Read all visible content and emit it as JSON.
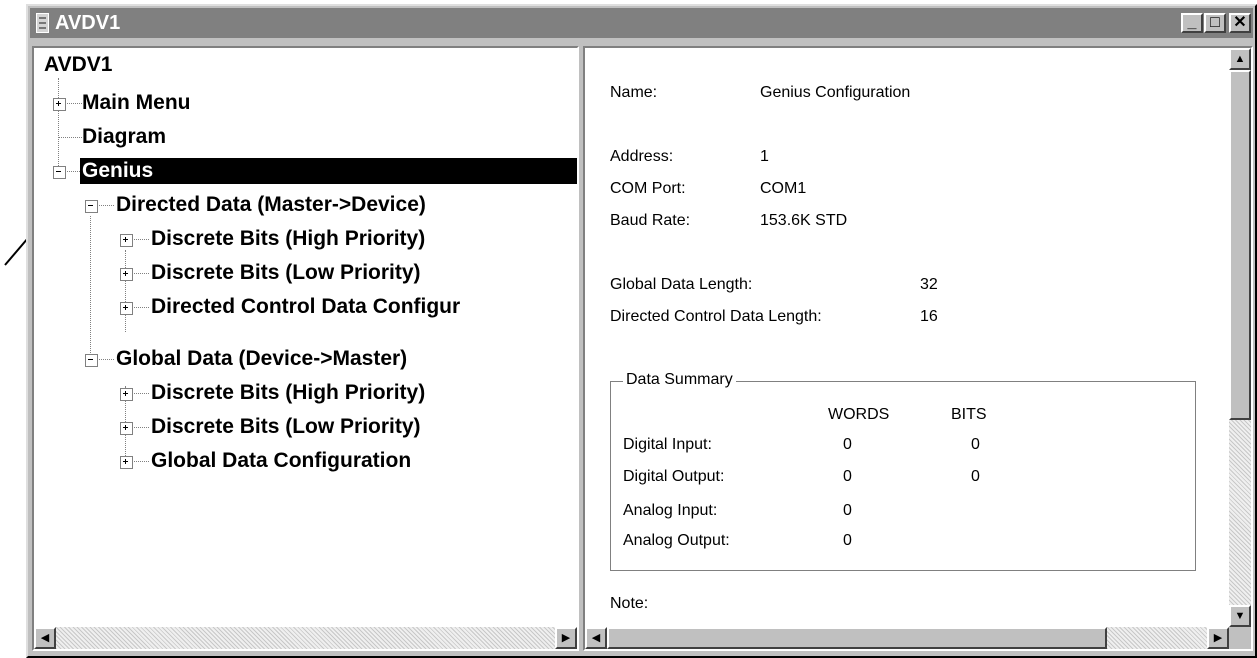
{
  "window": {
    "title": "AVDV1",
    "minimize_glyph": "_",
    "maximize_glyph": "□",
    "close_glyph": "✕"
  },
  "tree": {
    "root": "AVDV1",
    "items": [
      {
        "label": "Main Menu",
        "expander": "plus"
      },
      {
        "label": "Diagram",
        "expander": "none"
      },
      {
        "label": "Genius",
        "expander": "minus",
        "selected": true
      },
      {
        "label": "Directed Data (Master->Device)",
        "expander": "minus"
      },
      {
        "label": "Discrete Bits (High Priority)",
        "expander": "plus"
      },
      {
        "label": "Discrete Bits (Low Priority)",
        "expander": "plus"
      },
      {
        "label": "Directed Control Data Configur",
        "expander": "plus"
      },
      {
        "label": "Global Data (Device->Master)",
        "expander": "minus"
      },
      {
        "label": "Discrete Bits (High Priority)",
        "expander": "plus"
      },
      {
        "label": "Discrete Bits (Low Priority)",
        "expander": "plus"
      },
      {
        "label": "Global Data Configuration",
        "expander": "plus"
      }
    ]
  },
  "details": {
    "name_label": "Name:",
    "name_value": "Genius Configuration",
    "address_label": "Address:",
    "address_value": "1",
    "com_port_label": "COM Port:",
    "com_port_value": "COM1",
    "baud_rate_label": "Baud Rate:",
    "baud_rate_value": "153.6K STD",
    "global_length_label": "Global Data Length:",
    "global_length_value": "32",
    "directed_length_label": "Directed Control Data Length:",
    "directed_length_value": "16",
    "summary": {
      "title": "Data Summary",
      "col_words": "WORDS",
      "col_bits": "BITS",
      "rows": [
        {
          "label": "Digital Input:",
          "words": "0",
          "bits": "0"
        },
        {
          "label": "Digital Output:",
          "words": "0",
          "bits": "0"
        },
        {
          "label": "Analog Input:",
          "words": "0",
          "bits": ""
        },
        {
          "label": "Analog Output:",
          "words": "0",
          "bits": ""
        }
      ]
    },
    "note_label": "Note:"
  },
  "icons": {
    "scroll_left": "◀",
    "scroll_right": "▶",
    "scroll_up": "▲",
    "scroll_down": "▼"
  }
}
